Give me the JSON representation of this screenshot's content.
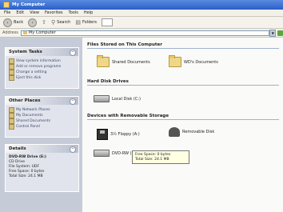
{
  "window": {
    "title": "My Computer"
  },
  "menu": [
    "File",
    "Edit",
    "View",
    "Favorites",
    "Tools",
    "Help"
  ],
  "toolbar": {
    "back": "Back",
    "search": "Search",
    "folders": "Folders"
  },
  "address": {
    "label": "Address",
    "value": "My Computer"
  },
  "tasks": {
    "system": {
      "title": "System Tasks",
      "items": [
        "View system information",
        "Add or remove programs",
        "Change a setting",
        "Eject this disk"
      ]
    },
    "other": {
      "title": "Other Places",
      "items": [
        "My Network Places",
        "My Documents",
        "Shared Documents",
        "Control Panel"
      ]
    },
    "details": {
      "title": "Details",
      "lines": [
        "DVD-RW Drive (E:)",
        "CD Drive",
        "File System: UDF",
        "Free Space: 0 bytes",
        "Total Size: 24.1 MB"
      ]
    }
  },
  "content": {
    "files_group": "Files Stored on This Computer",
    "shared_docs": "Shared Documents",
    "my_docs": "WD's Documents",
    "hdd_group": "Hard Disk Drives",
    "local_disk": "Local Disk (C:)",
    "removable_group": "Devices with Removable Storage",
    "floppy": "3½ Floppy (A:)",
    "usb_drive": "DVD-RW (E:)",
    "unknown_device": "Removable Disk"
  },
  "tooltip": {
    "free_space": "Free Space: 0 bytes",
    "total_size": "Total Size: 24.1 MB"
  },
  "colors": {
    "titlebar": "#2b5fc8",
    "taskpane": "#c6cbd8",
    "panel": "#e1e4ec",
    "folder": "#f0d688"
  }
}
